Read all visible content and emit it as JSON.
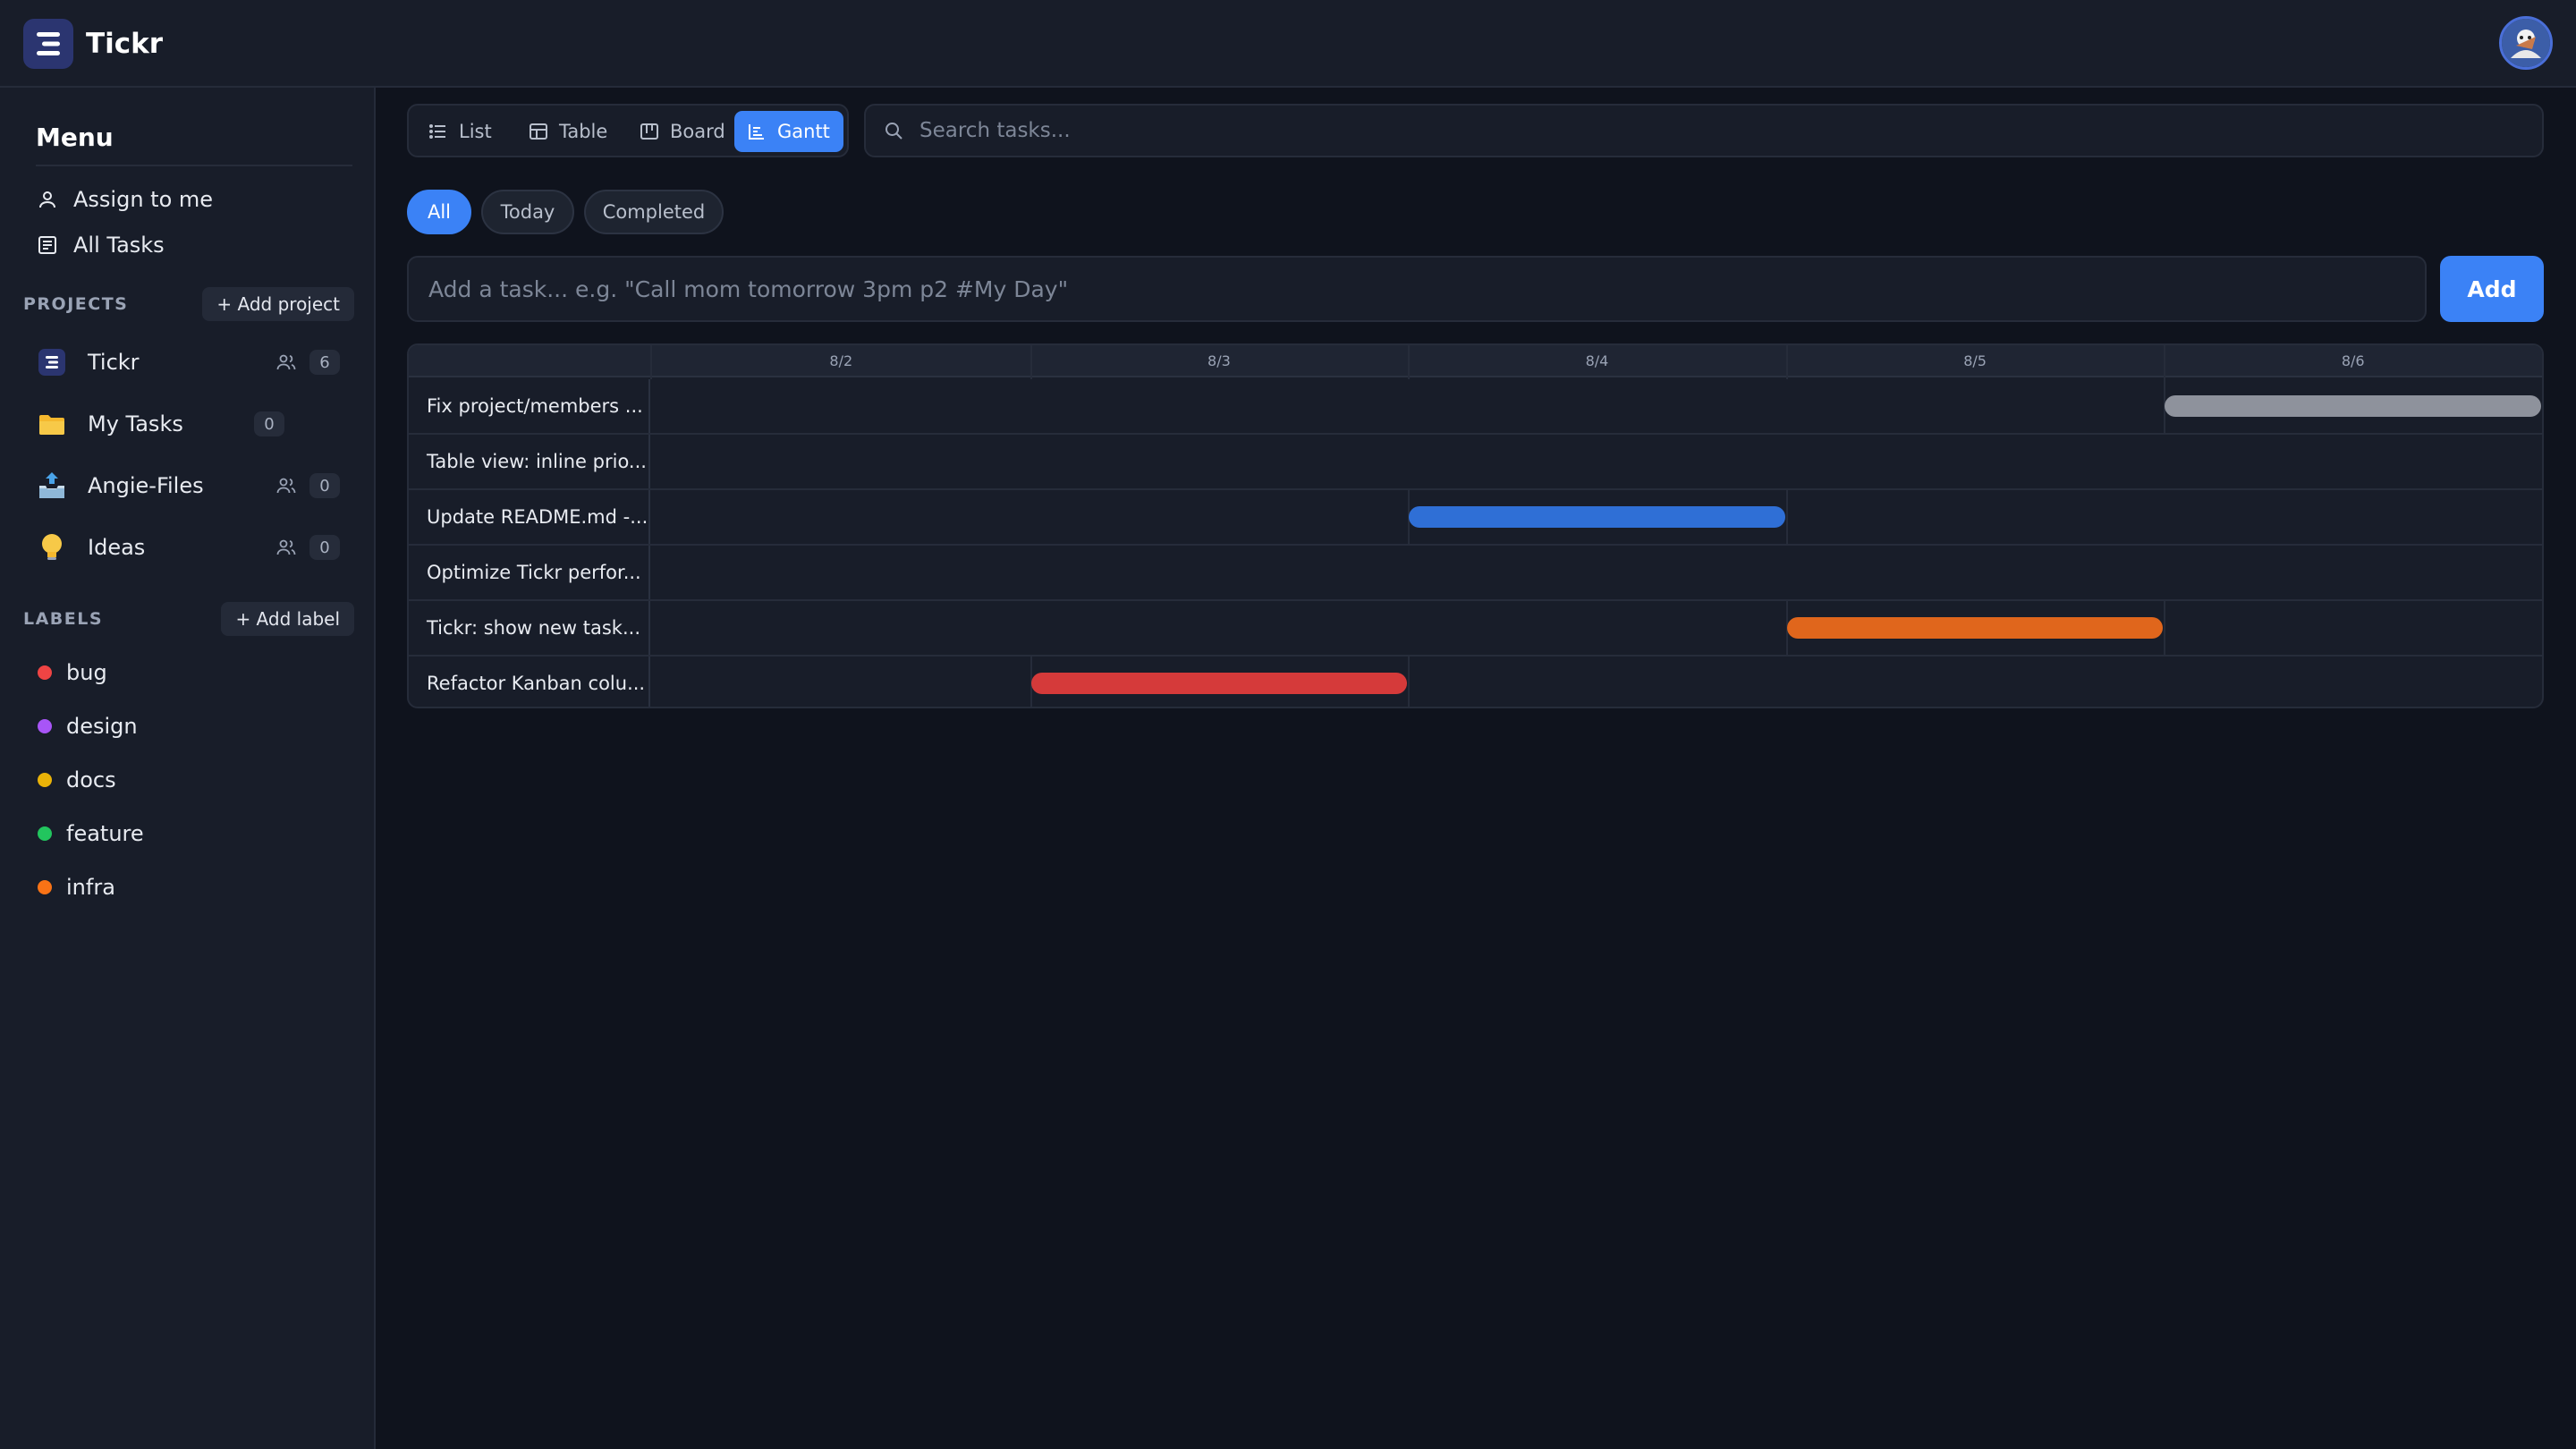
{
  "app": {
    "title": "Tickr",
    "logo_icon": "tickr-logo-icon",
    "avatar_icon": "user-avatar"
  },
  "sidebar": {
    "menu_title": "Menu",
    "nav": [
      {
        "label": "Assign to me",
        "icon": "user-icon"
      },
      {
        "label": "All Tasks",
        "icon": "list-box-icon"
      }
    ],
    "projects_label": "PROJECTS",
    "add_project": "+ Add project",
    "projects": [
      {
        "name": "Tickr",
        "icon": "tickr-logo-icon",
        "shared": true,
        "count": "6"
      },
      {
        "name": "My Tasks",
        "icon": "folder-icon",
        "shared": false,
        "count": "0"
      },
      {
        "name": "Angie-Files",
        "icon": "inbox-tray-icon",
        "shared": true,
        "count": "0"
      },
      {
        "name": "Ideas",
        "icon": "lightbulb-icon",
        "shared": true,
        "count": "0"
      }
    ],
    "labels_label": "LABELS",
    "add_label": "+ Add label",
    "labels": [
      {
        "name": "bug",
        "color": "#ef4444"
      },
      {
        "name": "design",
        "color": "#a855f7"
      },
      {
        "name": "docs",
        "color": "#eab308"
      },
      {
        "name": "feature",
        "color": "#22c55e"
      },
      {
        "name": "infra",
        "color": "#f97316"
      }
    ]
  },
  "toolbar": {
    "views": [
      {
        "label": "List",
        "icon": "list-icon",
        "active": false
      },
      {
        "label": "Table",
        "icon": "table-icon",
        "active": false
      },
      {
        "label": "Board",
        "icon": "board-icon",
        "active": false
      },
      {
        "label": "Gantt",
        "icon": "gantt-icon",
        "active": true
      }
    ],
    "search_placeholder": "Search tasks..."
  },
  "filters": [
    {
      "label": "All",
      "active": true
    },
    {
      "label": "Today",
      "active": false
    },
    {
      "label": "Completed",
      "active": false
    }
  ],
  "add_task": {
    "placeholder": "Add a task... e.g. \"Call mom tomorrow 3pm p2 #My Day\"",
    "button": "Add"
  },
  "gantt": {
    "dates": [
      "8/2",
      "8/3",
      "8/4",
      "8/5",
      "8/6"
    ],
    "tasks": [
      {
        "name": "Fix project/members ...",
        "start": "8/6",
        "end": "8/6",
        "color": "#8e929c"
      },
      {
        "name": "Table view: inline prio...",
        "start": null,
        "end": null,
        "color": null
      },
      {
        "name": "Update README.md -...",
        "start": "8/4",
        "end": "8/4",
        "color": "#2f6fd6"
      },
      {
        "name": "Optimize Tickr perfor...",
        "start": null,
        "end": null,
        "color": null
      },
      {
        "name": "Tickr: show new task...",
        "start": "8/5",
        "end": "8/5",
        "color": "#e0661c"
      },
      {
        "name": "Refactor Kanban colu...",
        "start": "8/3",
        "end": "8/3",
        "color": "#d53a3a"
      }
    ]
  }
}
